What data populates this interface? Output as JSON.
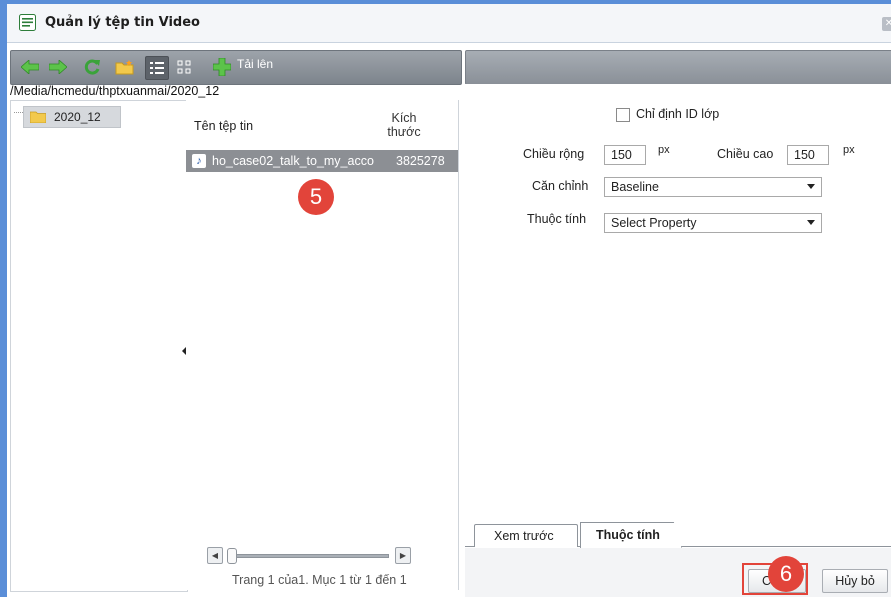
{
  "window": {
    "title": "Quản lý tệp tin Video"
  },
  "toolbar": {
    "buttons": [
      {
        "name": "back-icon"
      },
      {
        "name": "forward-icon"
      },
      {
        "name": "refresh-icon"
      },
      {
        "name": "new-folder-icon"
      },
      {
        "name": "list-view-icon"
      },
      {
        "name": "thumbnail-view-icon"
      }
    ],
    "upload_label": "Tải lên"
  },
  "path": "/Media/hcmedu/thptxuanmai/2020_12",
  "tree": {
    "items": [
      {
        "label": "2020_12",
        "selected": true
      }
    ]
  },
  "file_list": {
    "columns": {
      "name": "Tên tệp tin",
      "size_line1": "Kích",
      "size_line2": "thước"
    },
    "rows": [
      {
        "name": "ho_case02_talk_to_my_acco",
        "size": "3825278",
        "selected": true
      }
    ]
  },
  "annotations": {
    "step5": "5",
    "step6": "6"
  },
  "pagination": {
    "info": "Trang 1 của1. Mục 1 từ 1 đến 1"
  },
  "properties": {
    "css_class_label": "Chỉ định ID lớp",
    "css_class_checked": false,
    "width_label": "Chiều rộng",
    "width_value": "150",
    "width_unit": "px",
    "height_label": "Chiều cao",
    "height_value": "150",
    "height_unit": "px",
    "align_label": "Căn chỉnh",
    "align_value": "Baseline",
    "property_label": "Thuộc tính",
    "property_value": "Select Property"
  },
  "tabs": [
    {
      "label": "Xem trước",
      "active": false
    },
    {
      "label": "Thuộc tính",
      "active": true
    }
  ],
  "footer": {
    "insert_label": "Chèn",
    "cancel_label": "Hủy bỏ"
  },
  "colors": {
    "accent_border": "#5a8ed8",
    "highlight_red": "#e2443a",
    "selected_row": "#8c8f94"
  }
}
